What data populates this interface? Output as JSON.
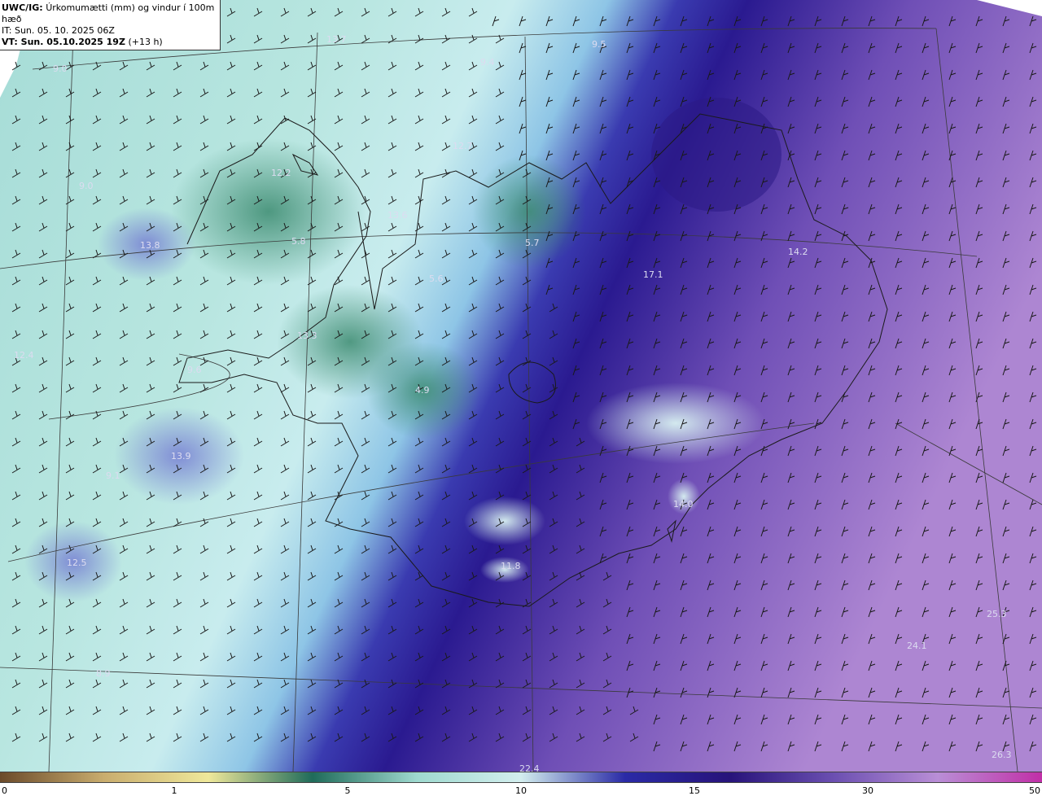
{
  "header": {
    "model": "UWC/IG:",
    "title": "Úrkomumætti (mm) og vindur í 100m hæð",
    "issue_time": "IT: Sun. 05. 10. 2025 06Z",
    "valid_time": "VT: Sun. 05.10.2025 19Z",
    "lead": "(+13 h)"
  },
  "map_labels": [
    "13.7",
    "9.4",
    "9.5",
    "9.0",
    "12.7",
    "12.2",
    "9.0",
    "13.6",
    "13.8",
    "5.8",
    "5.7",
    "14.2",
    "17.1",
    "5.6",
    "12.4",
    "13.3",
    "9.6",
    "4.9",
    "13.9",
    "9.1",
    "14.0",
    "11.8",
    "12.5",
    "25.3",
    "24.1",
    "8.9",
    "22.4",
    "26.3"
  ],
  "colorbar": {
    "ticks": [
      "0",
      "1",
      "5",
      "10",
      "15",
      "30",
      "50"
    ],
    "colors": [
      "#6b4a2a",
      "#c9ad6e",
      "#efe89a",
      "#1f6b5a",
      "#9ed9cf",
      "#d3eeee",
      "#2a2aa6",
      "#27137a",
      "#6b4fb1",
      "#b98ed6",
      "#c12fa7"
    ]
  },
  "colors": {
    "land_outline": "#1a1a1a",
    "graticule": "#3a3a3a",
    "barb": "#1a1a1a"
  }
}
